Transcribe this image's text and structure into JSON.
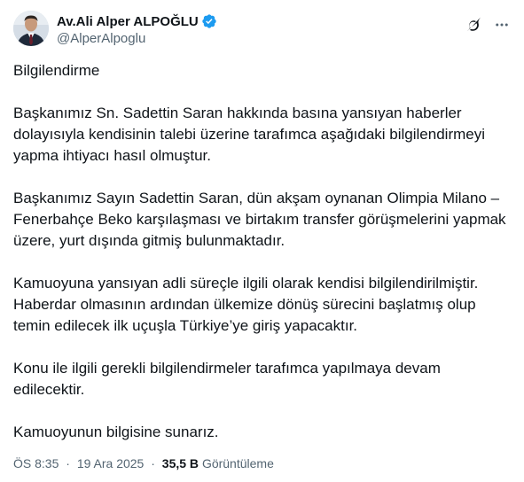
{
  "author": {
    "display_name": "Av.Ali Alper ALPOĞLU",
    "handle": "@AlperAlpoglu",
    "verified": true
  },
  "actions": {
    "grok_icon": "grok-icon",
    "more_icon": "more-icon"
  },
  "post": {
    "paragraphs": [
      "Bilgilendirme",
      "Başkanımız Sn. Sadettin Saran hakkında basına yansıyan haberler dolayısıyla  kendisinin talebi üzerine tarafımca  aşağıdaki bilgilendirmeyi yapma ihtiyacı hasıl olmuştur.",
      "Başkanımız Sayın Sadettin Saran, dün akşam oynanan Olimpia Milano – Fenerbahçe Beko karşılaşması ve birtakım transfer görüşmelerini yapmak üzere, yurt dışında gitmiş bulunmaktadır.",
      "Kamuoyuna yansıyan adli süreçle ilgili olarak kendisi bilgilendirilmiştir. Haberdar olmasının ardından ülkemize dönüş sürecini başlatmış olup temin edilecek ilk uçuşla Türkiye’ye giriş yapacaktır.",
      "Konu ile ilgili gerekli bilgilendirmeler tarafımca yapılmaya devam edilecektir.",
      "Kamuoyunun bilgisine sunarız."
    ]
  },
  "meta": {
    "time": "ÖS 8:35",
    "separator": "·",
    "date": "19 Ara 2025",
    "views_count": "35,5 B",
    "views_label": "Görüntüleme"
  },
  "colors": {
    "text": "#0f1419",
    "secondary": "#536471",
    "verified": "#1d9bf0"
  }
}
